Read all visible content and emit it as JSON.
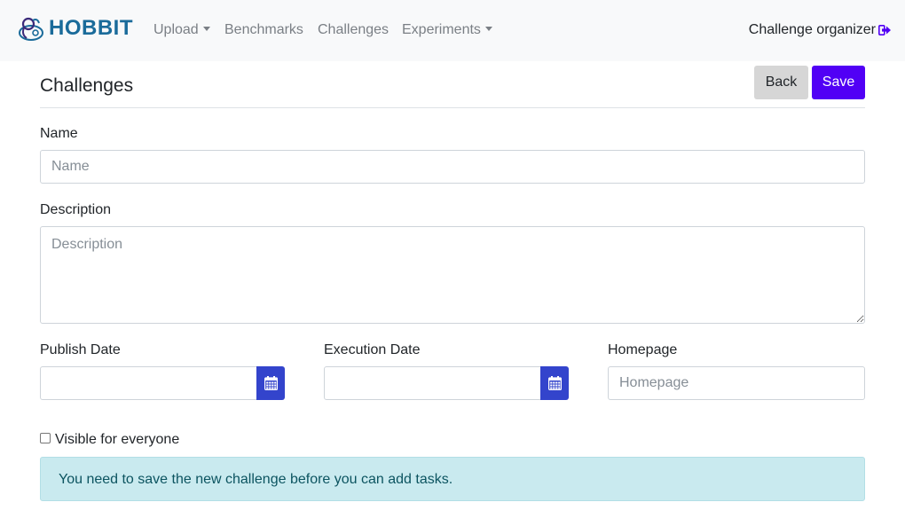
{
  "navbar": {
    "brand": "HOBBIT",
    "items": [
      {
        "label": "Upload",
        "dropdown": true
      },
      {
        "label": "Benchmarks",
        "dropdown": false
      },
      {
        "label": "Challenges",
        "dropdown": false
      },
      {
        "label": "Experiments",
        "dropdown": true
      }
    ],
    "user": "Challenge organizer",
    "user_icon": "sign-out-icon",
    "brand_color": "#1a6b9a"
  },
  "page": {
    "title": "Challenges",
    "back_label": "Back",
    "save_label": "Save",
    "save_color": "#5100f5"
  },
  "form": {
    "name": {
      "label": "Name",
      "placeholder": "Name",
      "value": ""
    },
    "description": {
      "label": "Description",
      "placeholder": "Description",
      "value": ""
    },
    "publish_date": {
      "label": "Publish Date",
      "value": "",
      "icon": "calendar-icon"
    },
    "execution_date": {
      "label": "Execution Date",
      "value": "",
      "icon": "calendar-icon"
    },
    "homepage": {
      "label": "Homepage",
      "placeholder": "Homepage",
      "value": ""
    },
    "visible": {
      "label": "Visible for everyone",
      "checked": false
    }
  },
  "alert": {
    "text": "You need to save the new challenge before you can add tasks."
  }
}
